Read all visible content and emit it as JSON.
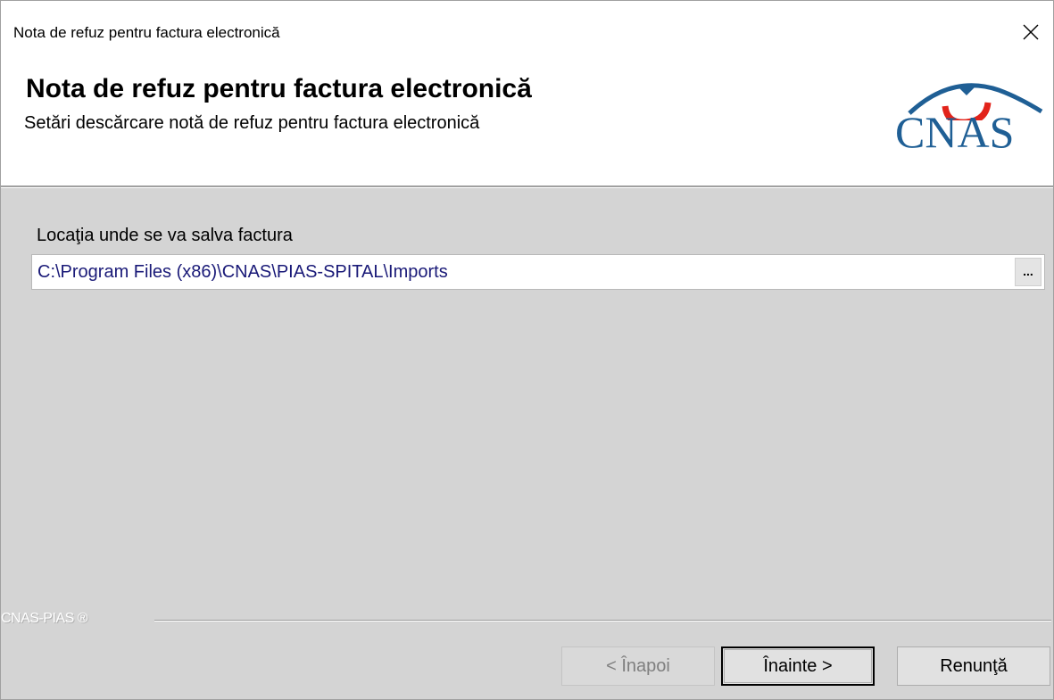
{
  "window": {
    "title": "Nota de refuz pentru factura electronică"
  },
  "header": {
    "title": "Nota de refuz pentru factura electronică",
    "subtitle": "Setări descărcare notă de refuz pentru factura electronică",
    "logo_text": "CNAS",
    "logo_colors": {
      "text": "#1f5f95",
      "arc": "#e2231a",
      "roof": "#1f5f95"
    }
  },
  "form": {
    "location_label": "Locaţia unde se va salva factura",
    "location_value": "C:\\Program Files (x86)\\CNAS\\PIAS-SPITAL\\Imports",
    "browse_label": "..."
  },
  "footer": {
    "brand": "CNAS-PIAS ®",
    "back_label": "< Înapoi",
    "next_label": "Înainte >",
    "cancel_label": "Renunţă"
  },
  "icons": {
    "close": "close-icon",
    "browse": "ellipsis-icon"
  }
}
